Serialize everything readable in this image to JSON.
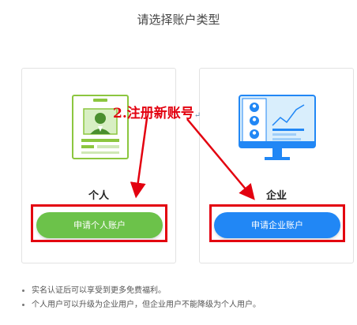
{
  "page": {
    "title": "请选择账户类型"
  },
  "cards": {
    "personal": {
      "label": "个人",
      "button_label": "申请个人账户"
    },
    "enterprise": {
      "label": "企业",
      "button_label": "申请企业账户"
    }
  },
  "annotation": {
    "text": "2.注册新账号",
    "mark": "↵"
  },
  "notes": [
    "实名认证后可以享受到更多免费福利。",
    "个人用户可以升级为企业用户，但企业用户不能降级为个人用户。"
  ],
  "colors": {
    "green_button": "#6cc24a",
    "blue_button": "#2187f5",
    "annotation_red": "#e3000f"
  }
}
